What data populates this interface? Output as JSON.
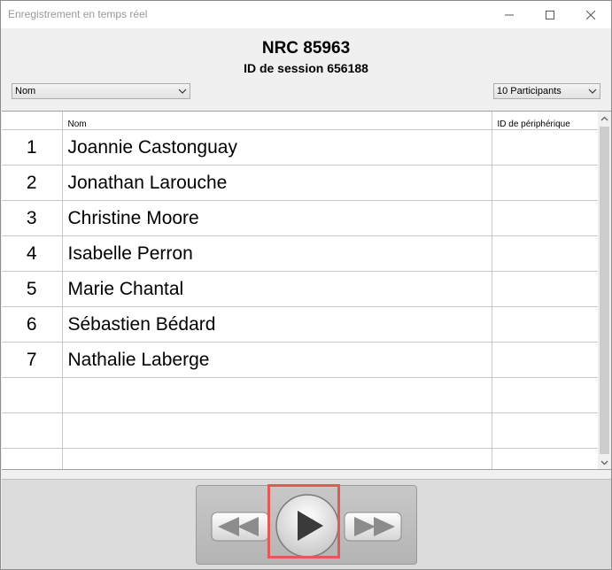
{
  "window": {
    "title": "Enregistrement en temps réel",
    "controls": [
      "minimize-icon",
      "maximize-icon",
      "close-icon"
    ]
  },
  "header": {
    "nrc": "NRC 85963",
    "session": "ID de session 656188"
  },
  "filters": {
    "sort_select": "Nom",
    "participants_select": "10 Participants"
  },
  "table": {
    "columns": [
      "",
      "Nom",
      "ID de périphérique"
    ],
    "rows": [
      {
        "num": "1",
        "name": "Joannie Castonguay",
        "device": ""
      },
      {
        "num": "2",
        "name": "Jonathan Larouche",
        "device": ""
      },
      {
        "num": "3",
        "name": "Christine Moore",
        "device": ""
      },
      {
        "num": "4",
        "name": "Isabelle Perron",
        "device": ""
      },
      {
        "num": "5",
        "name": "Marie Chantal",
        "device": ""
      },
      {
        "num": "6",
        "name": "Sébastien Bédard",
        "device": ""
      },
      {
        "num": "7",
        "name": "Nathalie Laberge",
        "device": ""
      },
      {
        "num": "",
        "name": "",
        "device": ""
      },
      {
        "num": "",
        "name": "",
        "device": ""
      },
      {
        "num": "",
        "name": "",
        "device": ""
      }
    ]
  },
  "playback": {
    "buttons": [
      "rewind-icon",
      "play-icon",
      "fast-forward-icon"
    ],
    "highlight_color": "#e05a5a"
  }
}
